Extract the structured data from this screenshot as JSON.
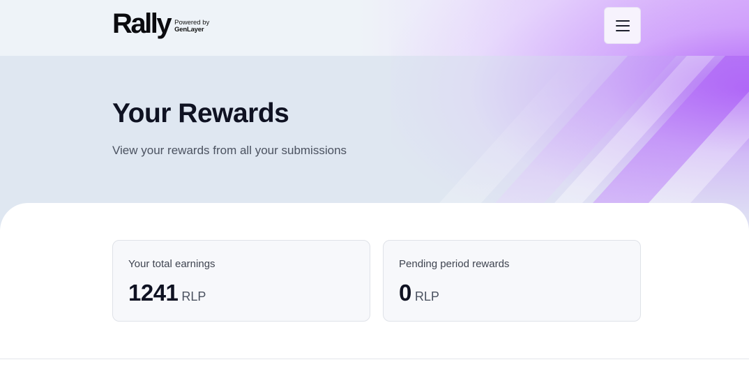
{
  "header": {
    "logo_word": "Rally",
    "logo_powered": "Powered by",
    "logo_brand": "GenLayer",
    "menu_icon": "hamburger-menu-icon"
  },
  "hero": {
    "title": "Your Rewards",
    "subtitle": "View your rewards from all your submissions"
  },
  "cards": [
    {
      "label": "Your total earnings",
      "value": "1241",
      "unit": "RLP"
    },
    {
      "label": "Pending period rewards",
      "value": "0",
      "unit": "RLP"
    }
  ],
  "colors": {
    "accent_purple": "#a855f7",
    "background": "#dfe7f1",
    "text_dark": "#0f1222"
  }
}
